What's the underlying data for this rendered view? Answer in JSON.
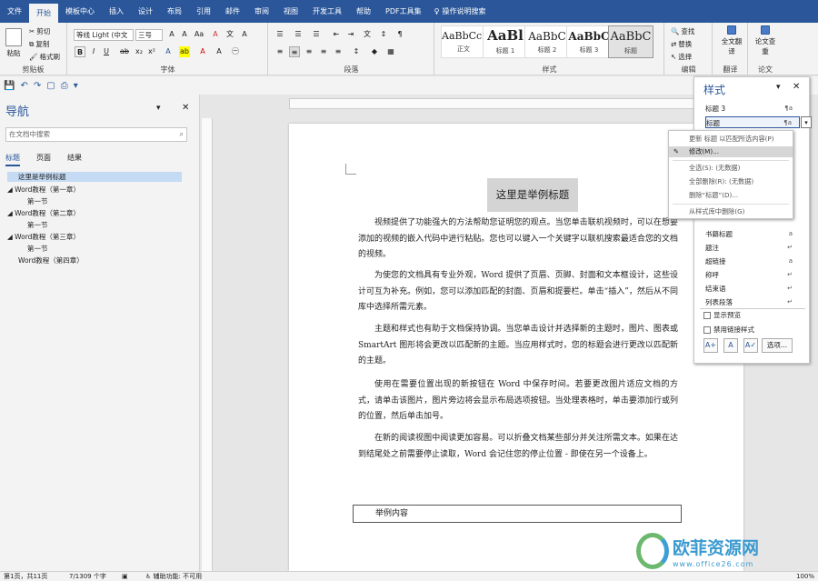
{
  "tabs": [
    "文件",
    "开始",
    "模板中心",
    "插入",
    "设计",
    "布局",
    "引用",
    "邮件",
    "审阅",
    "视图",
    "开发工具",
    "帮助",
    "PDF工具集"
  ],
  "tell_me": "操作说明搜索",
  "clipboard": {
    "paste": "粘贴",
    "cut": "剪切",
    "copy": "复制",
    "format_painter": "格式刷",
    "label": "剪贴板"
  },
  "font": {
    "family": "等线 Light (中文",
    "size": "三号",
    "label": "字体"
  },
  "paragraph": {
    "label": "段落"
  },
  "styles": {
    "label": "样式",
    "items": [
      {
        "preview": "AaBbCcI",
        "name": "正文"
      },
      {
        "preview": "AaBl",
        "name": "标题 1"
      },
      {
        "preview": "AaBbC",
        "name": "标题 2"
      },
      {
        "preview": "AaBbC",
        "name": "标题 3"
      },
      {
        "preview": "AaBbC",
        "name": "标题"
      }
    ]
  },
  "editing": {
    "find": "查找",
    "replace": "替换",
    "select": "选择",
    "label": "编辑"
  },
  "translate": {
    "btn": "全文翻译",
    "label": "翻译"
  },
  "paper": {
    "btn": "论文查重",
    "label": "论文"
  },
  "nav": {
    "title": "导航",
    "search_placeholder": "在文档中搜索",
    "tabs": [
      "标题",
      "页面",
      "结果"
    ],
    "items": [
      "这里是举例标题",
      "Word教程（第一章）",
      "第一节",
      "Word教程（第二章）",
      "第一节",
      "Word教程（第三章）",
      "第一节",
      "Word教程（第四章）"
    ]
  },
  "doc": {
    "title": "这里是举例标题",
    "paragraphs": [
      "视频提供了功能强大的方法帮助您证明您的观点。当您单击联机视频时，可以在想要添加的视频的嵌入代码中进行粘贴。您也可以键入一个关键字以联机搜索最适合您的文档的视频。",
      "为使您的文档具有专业外观，Word 提供了页眉、页脚、封面和文本框设计，这些设计可互为补充。例如，您可以添加匹配的封面、页眉和提要栏。单击“插入”，然后从不同库中选择所需元素。",
      "主题和样式也有助于文档保持协调。当您单击设计并选择新的主题时，图片、图表或 SmartArt 图形将会更改以匹配新的主题。当应用样式时，您的标题会进行更改以匹配新的主题。",
      "使用在需要位置出现的新按钮在 Word 中保存时间。若要更改图片适应文档的方式，请单击该图片，图片旁边将会显示布局选项按钮。当处理表格时，单击要添加行或列的位置，然后单击加号。",
      "在新的阅读视图中阅读更加容易。可以折叠文档某些部分并关注所需文本。如果在达到结尾处之前需要停止读取，Word 会记住您的停止位置 - 即使在另一个设备上。"
    ],
    "box_text": "举例内容"
  },
  "styles_pane": {
    "title": "样式",
    "top_rows": [
      {
        "name": "标题 3",
        "mark": "¶a"
      },
      {
        "name": "标题",
        "mark": "¶a"
      }
    ],
    "rows": [
      {
        "name": "书籍标题",
        "mark": "a"
      },
      {
        "name": "题注",
        "mark": "↵"
      },
      {
        "name": "超链接",
        "mark": "a"
      },
      {
        "name": "称呼",
        "mark": "↵"
      },
      {
        "name": "结束语",
        "mark": "↵"
      },
      {
        "name": "列表段落",
        "mark": "↵"
      }
    ],
    "show_preview": "显示预览",
    "disable_linked": "禁用链接样式",
    "options": "选项..."
  },
  "context_menu": [
    "更新 标题 以匹配所选内容(P)",
    "修改(M)...",
    "全选(S): (无数据)",
    "全部删除(R): (无数据)",
    "删除“标题”(D)...",
    "从样式库中删除(G)"
  ],
  "status": {
    "page": "第1页，共11页",
    "words": "7/1309 个字",
    "accessibility": "辅助功能: 不可用",
    "zoom": "100%"
  },
  "watermark": {
    "name": "欧菲资源网",
    "url": "www.office26.com"
  }
}
